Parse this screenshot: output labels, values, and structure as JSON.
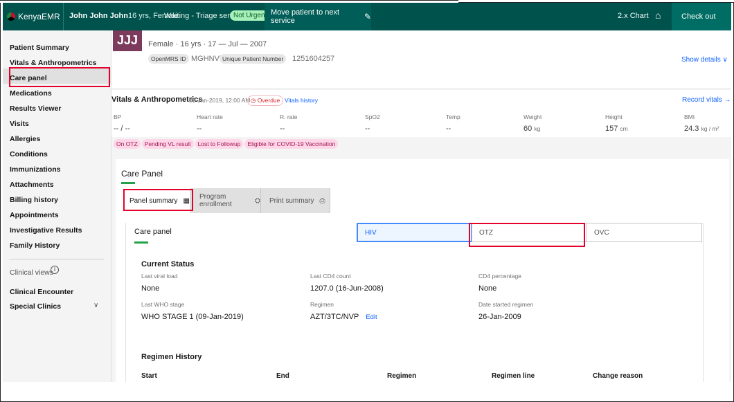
{
  "topbar": {
    "brand": "KenyaEMR",
    "patient_name": "John John John",
    "patient_meta": "16 yrs, Female",
    "queue_status": "Waiting - Triage service",
    "priority": "Not Urgent",
    "move_action": "Move patient to next service",
    "chart_label": "2.x Chart",
    "checkout_label": "Check out"
  },
  "sidebar": {
    "items": [
      "Patient Summary",
      "Vitals & Anthropometrics",
      "Care panel",
      "Medications",
      "Results Viewer",
      "Visits",
      "Allergies",
      "Conditions",
      "Immunizations",
      "Attachments",
      "Billing history",
      "Appointments",
      "Investigative Results",
      "Family History"
    ],
    "clinical_views": "Clinical views",
    "bottom_items": [
      "Clinical Encounter",
      "Special Clinics"
    ]
  },
  "banner": {
    "initials": "JJJ",
    "demographics": "Female · 16 yrs · 17 — Jul — 2007",
    "ids": [
      {
        "label": "OpenMRS ID",
        "value": "MGHNV7"
      },
      {
        "label": "Unique Patient Number",
        "value": "1251604257"
      }
    ],
    "show_details": "Show details ∨"
  },
  "vitals": {
    "title": "Vitals & Anthropometrics",
    "date": "09-Jan-2019, 12:00 AM",
    "overdue": "Overdue",
    "history_link": "Vitals history",
    "record_link": "Record vitals →",
    "items": [
      {
        "label": "BP",
        "value": "-- / --",
        "unit": ""
      },
      {
        "label": "Heart rate",
        "value": "--",
        "unit": ""
      },
      {
        "label": "R. rate",
        "value": "--",
        "unit": ""
      },
      {
        "label": "SpO2",
        "value": "--",
        "unit": ""
      },
      {
        "label": "Temp",
        "value": "--",
        "unit": ""
      },
      {
        "label": "Weight",
        "value": "60",
        "unit": "kg"
      },
      {
        "label": "Height",
        "value": "157",
        "unit": "cm"
      },
      {
        "label": "BMI",
        "value": "24.3",
        "unit": "kg / m²"
      }
    ]
  },
  "flags": [
    "On OTZ",
    "Pending VL result",
    "Lost to Followup",
    "Eligible for COVID-19 Vaccination"
  ],
  "care_panel": {
    "title": "Care Panel",
    "tabs": [
      "Panel summary",
      "Program enrollment",
      "Print summary"
    ],
    "inner_title": "Care panel",
    "programs": [
      "HIV",
      "OTZ",
      "OVC"
    ],
    "current_status_title": "Current Status",
    "status": {
      "last_viral_load_label": "Last viral load",
      "last_viral_load": "None",
      "last_cd4_label": "Last CD4 count",
      "last_cd4": "1207.0 (16-Jun-2008)",
      "cd4_pct_label": "CD4 percentage",
      "cd4_pct": "None",
      "who_stage_label": "Last WHO stage",
      "who_stage": "WHO STAGE 1 (09-Jan-2019)",
      "regimen_label": "Regimen",
      "regimen": "AZT/3TC/NVP",
      "edit": "Edit",
      "date_started_label": "Date started regimen",
      "date_started": "26-Jan-2009"
    },
    "regimen_history_title": "Regimen History",
    "regimen_columns": [
      "Start",
      "End",
      "Regimen",
      "Regimen line",
      "Change reason"
    ]
  }
}
